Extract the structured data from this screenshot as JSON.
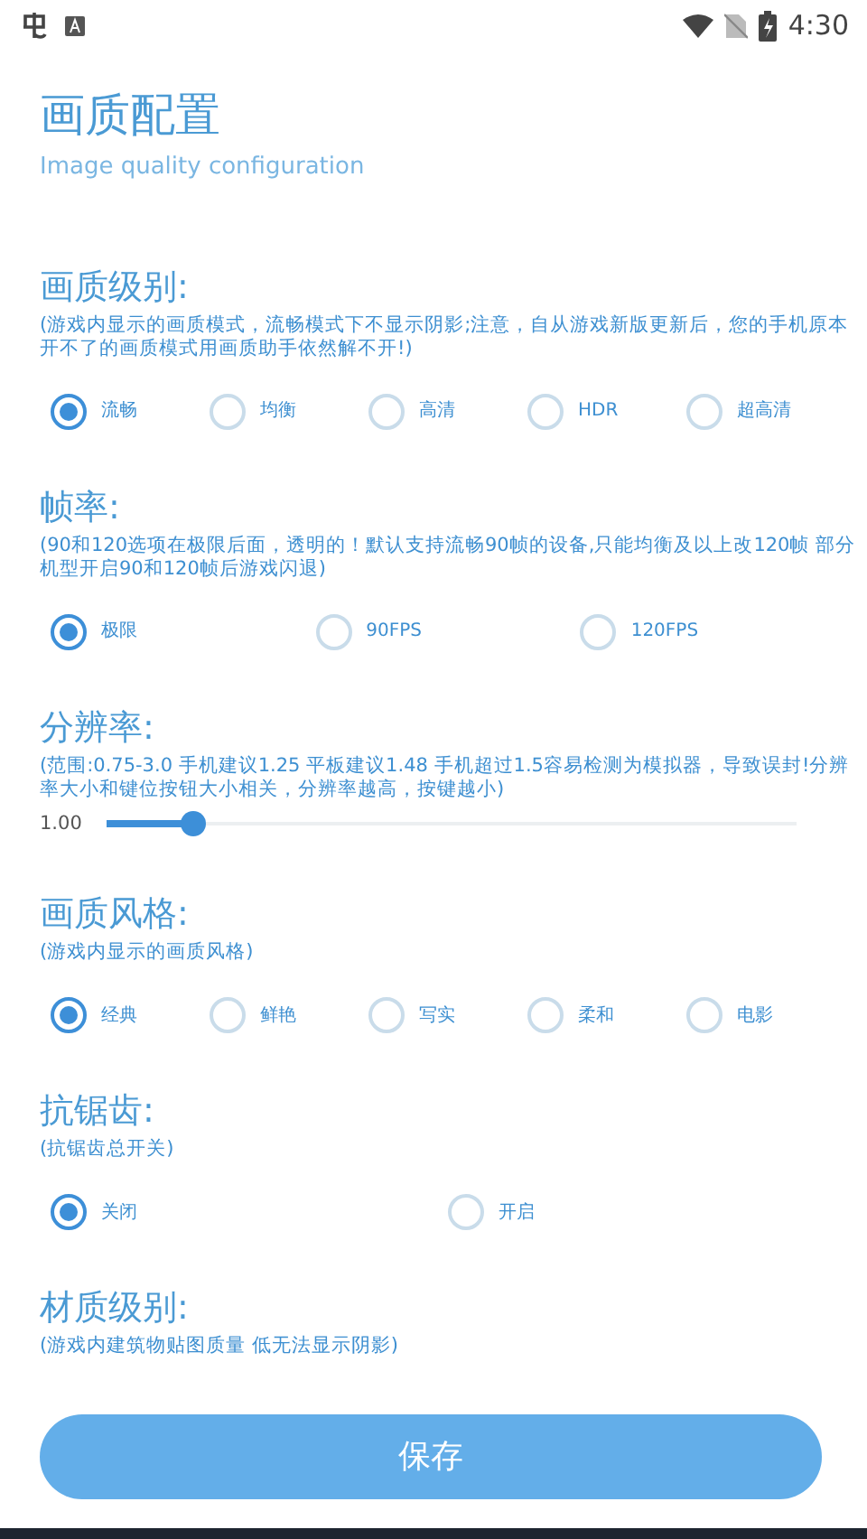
{
  "status_bar": {
    "time": "4:30"
  },
  "header": {
    "title": "画质配置",
    "subtitle": "Image quality configuration"
  },
  "sections": [
    {
      "kind": "radio",
      "title": "画质级别:",
      "note": "(游戏内显示的画质模式，流畅模式下不显示阴影;注意，自从游戏新版更新后，您的手机原本开不了的画质模式用画质助手依然解不开!)",
      "options": [
        {
          "label": "流畅",
          "selected": true
        },
        {
          "label": "均衡",
          "selected": false
        },
        {
          "label": "高清",
          "selected": false
        },
        {
          "label": "HDR",
          "selected": false
        },
        {
          "label": "超高清",
          "selected": false
        }
      ]
    },
    {
      "kind": "radio",
      "title": "帧率:",
      "note": "(90和120选项在极限后面，透明的！默认支持流畅90帧的设备,只能均衡及以上改120帧 部分机型开启90和120帧后游戏闪退)",
      "options": [
        {
          "label": "极限",
          "selected": true
        },
        {
          "label": "90FPS",
          "selected": false
        },
        {
          "label": "120FPS",
          "selected": false
        }
      ]
    },
    {
      "kind": "slider",
      "title": "分辨率:",
      "note": "(范围:0.75-3.0 手机建议1.25 平板建议1.48 手机超过1.5容易检测为模拟器，导致误封!分辨率大小和键位按钮大小相关，分辨率越高，按键越小)",
      "reading": "1.00",
      "level": 0.11
    },
    {
      "kind": "radio",
      "title": "画质风格:",
      "note": "(游戏内显示的画质风格)",
      "options": [
        {
          "label": "经典",
          "selected": true
        },
        {
          "label": "鲜艳",
          "selected": false
        },
        {
          "label": "写实",
          "selected": false
        },
        {
          "label": "柔和",
          "selected": false
        },
        {
          "label": "电影",
          "selected": false
        }
      ]
    },
    {
      "kind": "radio",
      "title": "抗锯齿:",
      "note": "(抗锯齿总开关)",
      "options": [
        {
          "label": "关闭",
          "selected": true
        },
        {
          "label": "开启",
          "selected": false
        }
      ]
    },
    {
      "kind": "note_only",
      "title": "材质级别:",
      "note": "(游戏内建筑物贴图质量 低无法显示阴影)"
    }
  ],
  "save_button": "保存"
}
